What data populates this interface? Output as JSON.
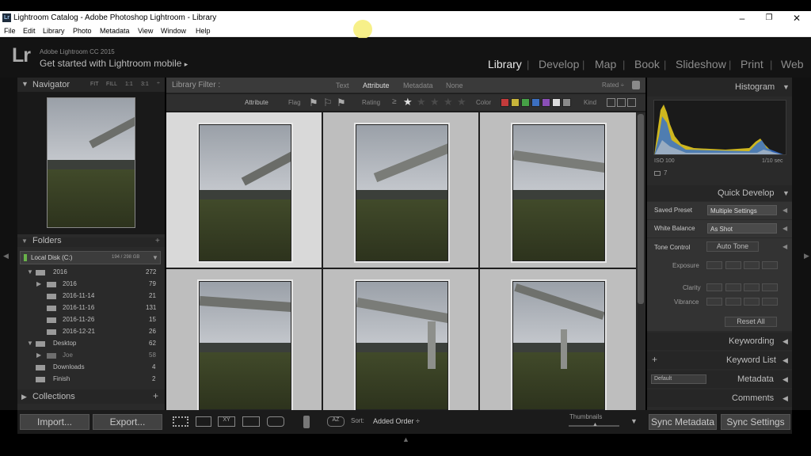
{
  "window": {
    "title": "Lightroom Catalog - Adobe Photoshop Lightroom - Library",
    "app_icon": "Lr",
    "minimize": "–",
    "maximize": "❐",
    "close": "✕"
  },
  "menu": [
    "File",
    "Edit",
    "Library",
    "Photo",
    "Metadata",
    "View",
    "Window",
    "Help"
  ],
  "identity": {
    "logo": "Lr",
    "product": "Adobe Lightroom CC 2015",
    "prompt": "Get started with Lightroom mobile",
    "arrow": "▸"
  },
  "modules": [
    "Library",
    "Develop",
    "Map",
    "Book",
    "Slideshow",
    "Print",
    "Web"
  ],
  "active_module": "Library",
  "navigator": {
    "title": "Navigator",
    "fit": "FIT",
    "fill": "FILL",
    "one": "1:1",
    "three": "3:1"
  },
  "folders": {
    "title": "Folders",
    "disk": {
      "name": "Local Disk (C:)",
      "usage": "194 / 298 GB"
    },
    "items": [
      {
        "name": "2016",
        "count": "272"
      },
      {
        "name": "2016",
        "count": "79"
      },
      {
        "name": "2016-11-14",
        "count": "21"
      },
      {
        "name": "2016-11-16",
        "count": "131"
      },
      {
        "name": "2016-11-26",
        "count": "15"
      },
      {
        "name": "2016-12-21",
        "count": "26"
      },
      {
        "name": "Desktop",
        "count": "62"
      },
      {
        "name": "Joe",
        "count": "58"
      },
      {
        "name": "Downloads",
        "count": "4"
      },
      {
        "name": "Finish",
        "count": "2"
      }
    ]
  },
  "collections": {
    "title": "Collections",
    "plus": "+"
  },
  "import_label": "Import...",
  "export_label": "Export...",
  "filterbar": {
    "label": "Library Filter :",
    "text": "Text",
    "attribute": "Attribute",
    "metadata": "Metadata",
    "none": "None",
    "rated": "Rated ÷"
  },
  "attributebar": {
    "attribute": "Attribute",
    "flag": "Flag",
    "rating": "Rating",
    "ge": "≥",
    "color": "Color",
    "kind": "Kind"
  },
  "color_labels": [
    "#c33b3b",
    "#c7b43a",
    "#46a046",
    "#3c6fc0",
    "#8a4fb6",
    "#dddddd",
    "#8a8a8a"
  ],
  "toolbar": {
    "sort_label": "Sort:",
    "sort_value": "Added Order ÷",
    "thumbnails_label": "Thumbnails"
  },
  "histogram": {
    "title": "Histogram",
    "iso": "ISO 100",
    "shutter": "1/10 sec",
    "count": "7"
  },
  "quick_develop": {
    "title": "Quick Develop",
    "saved_preset_label": "Saved Preset",
    "saved_preset_value": "Multiple Settings",
    "white_balance_label": "White Balance",
    "white_balance_value": "As Shot",
    "tone_control_label": "Tone Control",
    "auto_tone": "Auto Tone",
    "exposure": "Exposure",
    "clarity": "Clarity",
    "vibrance": "Vibrance",
    "reset_all": "Reset All"
  },
  "right_sections": {
    "keywording": "Keywording",
    "keyword_list": "Keyword List",
    "default": "Default",
    "metadata": "Metadata",
    "comments": "Comments"
  },
  "sync_metadata": "Sync Metadata",
  "sync_settings": "Sync Settings"
}
